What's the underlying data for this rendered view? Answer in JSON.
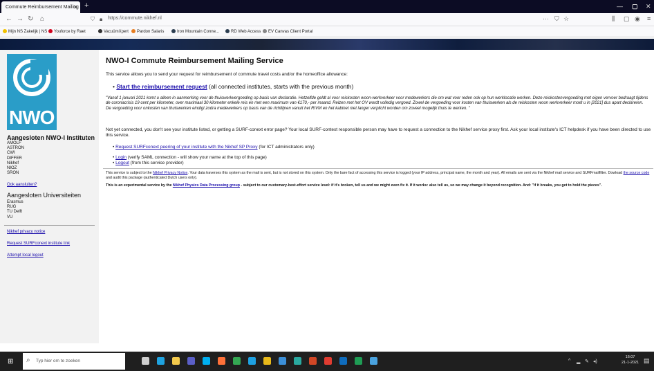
{
  "browser": {
    "tab_title": "Commute Reimbursement Mailing",
    "tab_close": "✕",
    "new_tab": "+",
    "url": "https://commute.nikhef.nl",
    "page_actions": "···",
    "bookmarks": [
      {
        "label": "Mijn NS Zakelijk | NS",
        "color": "#f2c200"
      },
      {
        "label": "Youforce by Raet",
        "color": "#d0021b"
      },
      {
        "label": "VacuümXpert",
        "color": "#333333"
      },
      {
        "label": "Pardon Salaris",
        "color": "#e67e22"
      },
      {
        "label": "Iron Mountain Conne...",
        "color": "#2c3e50"
      },
      {
        "label": "RD Web Access",
        "color": "#2c3e50"
      },
      {
        "label": "EV Canvas Client Portal",
        "color": "#888888"
      }
    ]
  },
  "sidebar": {
    "logo_text": "NWO",
    "institutes_heading": "Aangesloten NWO-I Instituten",
    "institutes": [
      "AMOLF",
      "ASTRON",
      "CWI",
      "DIFFER",
      "Nikhef",
      "NIOZ",
      "SRON"
    ],
    "join_link": "Ook aansluiten?",
    "universities_heading": "Aangesloten Universiteiten",
    "universities": [
      "Erasmus",
      "RUG",
      "TU Delft",
      "VU"
    ],
    "links": [
      "Nikhef privacy notice",
      "Request SURFconext institute link",
      "Attempt local logout"
    ]
  },
  "main": {
    "title": "NWO-I Commute Reimbursement Mailing Service",
    "intro": "This service allows you to send your request for reimbursement of commute travel costs and/or the homeoffice allowance:",
    "start_link": "Start the reimbursement request",
    "start_suffix": " (all connected institutes, starts with the previous month)",
    "dutch_notice": "\"Vanaf 1 januari 2021 komt u alleen in aanmerking voor de thuiswerkvergoeding op basis van declaratie. Hetzelfde geldt al voor reiskosten woon-werkverkeer voor medewerkers die om wat voor reden ook op hun werklocatie werken. Deze reiskostenvergoeding met eigen vervoer bedraagt tijdens de coronacrisis 19 cent per kilometer, over maximaal 30 kilometer enkele reis en met een maximum van €170,- per maand. Reizen met het OV wordt volledig vergoed. Zowel de vergoeding voor kosten van thuiswerken als de reiskosten woon werkverkeer moet u in [2021] dus apart declareren.\nDe vergoeding voor onkosten van thuiswerken eindigt zodra medewerkers op basis van de richtlijnen vanuit het RIVM en het kabinet niet langer verplicht worden om zoveel mogelijk thuis te werken. \"",
    "not_connected": "Not yet connected, you don't see your institute listed, or getting a SURF-conext error page? Your local SURF-context responsible person may have to request a connection to the Nikhef service proxy first. Ask your local institute's ICT helpdesk if you have been directed to use this service.",
    "peering_link": "Request SURFconext peering of your institute with the Nikhef SP Proxy",
    "peering_suffix": " (for ICT administrators only)",
    "login_link": "Login",
    "login_suffix": " (verify SAML connection - will show your name at the top of this page)",
    "logout_link": "Logout",
    "logout_suffix": " (from this service provider)",
    "footer1_pre": "This service is subject to the ",
    "footer1_link1": "Nikhef Privacy Notice",
    "footer1_mid": ". Your data traverses this system as the mail is sent, but is not stored on this system. Only the bare fact of accessing this service is logged (your IP address, principal name, the month and year). All emails are sent via the Nikhef mail service and SURFmailfilter. Dowload ",
    "footer1_link2": "the source code",
    "footer1_post": " and audit this package (authenticated Dutch users only).",
    "footer2_pre": "This is an experimental service by the ",
    "footer2_link": "Nikhef Physics Data Processing group",
    "footer2_post": " - subject to our customary-best-effort service level: if it's broken, tell us and we might even fix it. If it works: also tell us, so we may change it beyond recognition. And: \"if it breaks, you get to hold the pieces\"."
  },
  "taskbar": {
    "search_placeholder": "Typ hier om te zoeken",
    "time": "16:07",
    "date": "21-1-2021",
    "apps": [
      {
        "name": "task-view-icon",
        "color": "#cfcfcf"
      },
      {
        "name": "edge-icon",
        "color": "#1fa3e0"
      },
      {
        "name": "file-explorer-icon",
        "color": "#f2c94c"
      },
      {
        "name": "teams-icon",
        "color": "#5b5fc7"
      },
      {
        "name": "skype-icon",
        "color": "#00aff0"
      },
      {
        "name": "firefox-icon",
        "color": "#ff7139"
      },
      {
        "name": "chrome-icon",
        "color": "#34a853"
      },
      {
        "name": "ie-icon",
        "color": "#1ea1e2"
      },
      {
        "name": "powerbi-icon",
        "color": "#e8b91a"
      },
      {
        "name": "app-blue-icon",
        "color": "#3c8fd8"
      },
      {
        "name": "app-teal-icon",
        "color": "#2aa9a0"
      },
      {
        "name": "powerpoint-icon",
        "color": "#d24726"
      },
      {
        "name": "acrobat-icon",
        "color": "#e03c31"
      },
      {
        "name": "outlook-icon",
        "color": "#0f6cbd"
      },
      {
        "name": "excel-icon",
        "color": "#1f9d55"
      },
      {
        "name": "photos-icon",
        "color": "#4aa3df"
      }
    ]
  }
}
